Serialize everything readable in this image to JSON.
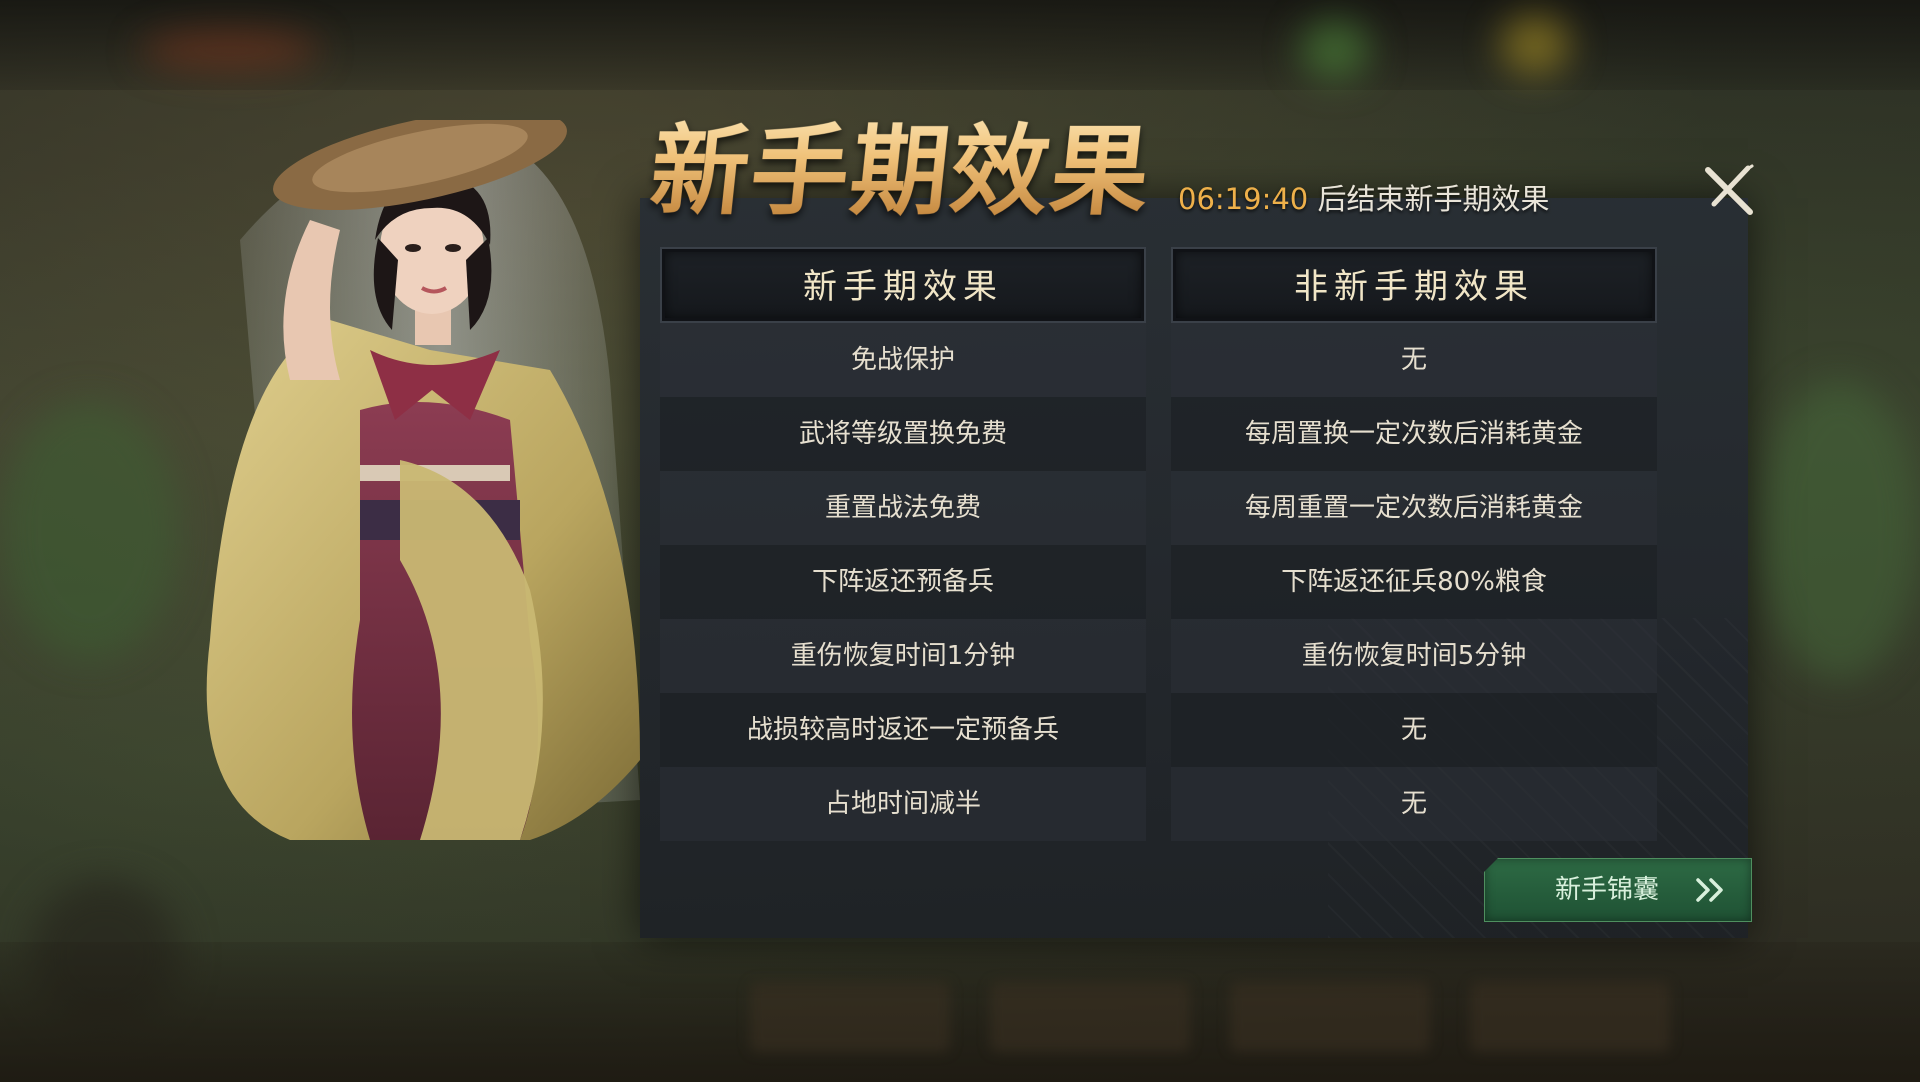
{
  "dialog": {
    "title": "新手期效果",
    "timer": "06:19:40",
    "timer_suffix": "后结束新手期效果"
  },
  "table": {
    "left_header": "新手期效果",
    "right_header": "非新手期效果",
    "rows": [
      {
        "newbie": "免战保护",
        "normal": "无"
      },
      {
        "newbie": "武将等级置换免费",
        "normal": "每周置换一定次数后消耗黄金"
      },
      {
        "newbie": "重置战法免费",
        "normal": "每周重置一定次数后消耗黄金"
      },
      {
        "newbie": "下阵返还预备兵",
        "normal": "下阵返还征兵80%粮食"
      },
      {
        "newbie": "重伤恢复时间1分钟",
        "normal": "重伤恢复时间5分钟"
      },
      {
        "newbie": "战损较高时返还一定预备兵",
        "normal": "无"
      },
      {
        "newbie": "占地时间减半",
        "normal": "无"
      }
    ]
  },
  "guide_button": {
    "label": "新手锦囊",
    "icon": "double-chevron-right-icon"
  },
  "close_button": {
    "icon": "close-icon"
  },
  "colors": {
    "title_gold": "#f0c27a",
    "timer_orange": "#eeb04a",
    "button_green": "#2d6a44",
    "panel_bg": "#282e34"
  }
}
